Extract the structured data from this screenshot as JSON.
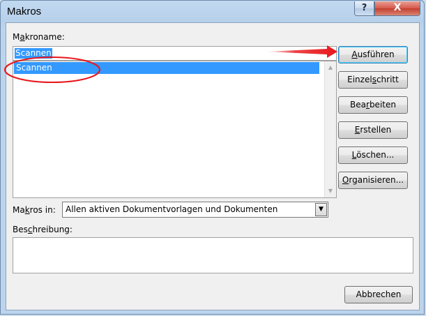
{
  "window": {
    "title": "Makros",
    "help_glyph": "?",
    "close_glyph": "X"
  },
  "makroname": {
    "label_pre": "M",
    "label_u": "a",
    "label_post": "kroname:",
    "value": "Scannen"
  },
  "list": {
    "items": [
      "Scannen"
    ]
  },
  "buttons": {
    "ausfuehren": {
      "pre": "",
      "u": "A",
      "post": "usführen"
    },
    "einzelschritt": {
      "pre": "Einzel",
      "u": "s",
      "post": "chritt"
    },
    "bearbeiten": {
      "pre": "Bea",
      "u": "r",
      "post": "beiten"
    },
    "erstellen": {
      "pre": "",
      "u": "E",
      "post": "rstellen"
    },
    "loeschen": {
      "pre": "",
      "u": "L",
      "post": "öschen..."
    },
    "organisieren": {
      "pre": "",
      "u": "O",
      "post": "rganisieren..."
    },
    "abbrechen": {
      "label": "Abbrechen"
    }
  },
  "makros_in": {
    "label_pre": "Ma",
    "label_u": "k",
    "label_post": "ros in:",
    "value": "Allen aktiven Dokumentvorlagen und Dokumenten"
  },
  "beschreibung": {
    "label_pre": "Bes",
    "label_u": "c",
    "label_post": "hreibung:",
    "value": ""
  },
  "colors": {
    "selection": "#3399ff",
    "annotation": "#e8161a"
  }
}
